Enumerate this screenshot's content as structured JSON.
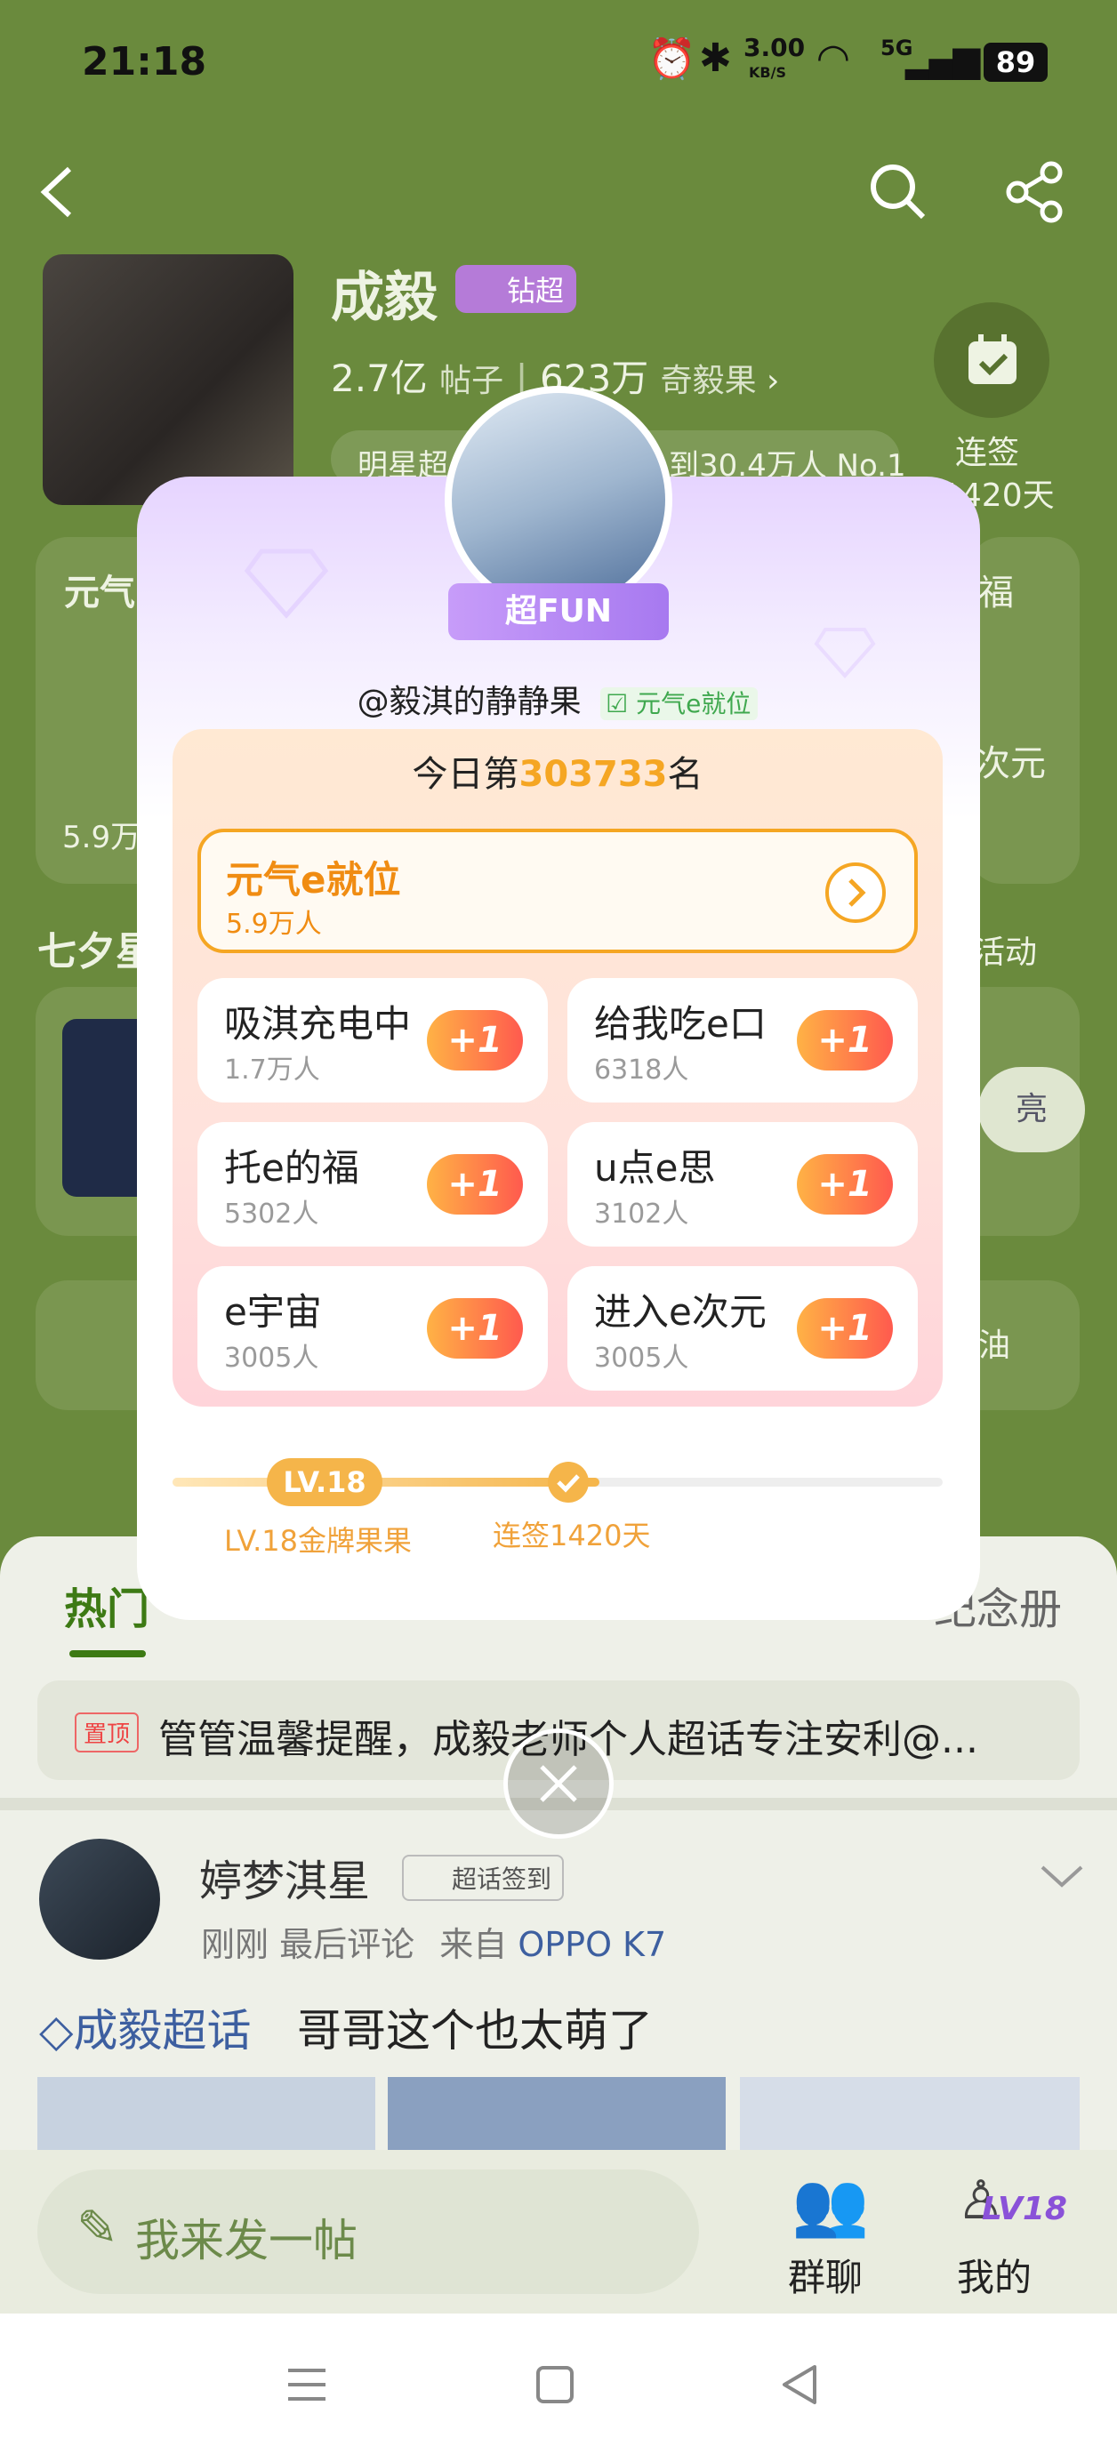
{
  "status_bar": {
    "time": "21:18",
    "speed": "3.00",
    "speed_unit": "KB/S",
    "battery": "89",
    "network": "5G"
  },
  "header": {
    "name": "成毅",
    "badge": "钻超",
    "posts": "2.7亿",
    "posts_label": "帖子",
    "fans": "623万",
    "fans_label": "奇毅果",
    "rank_text_left": "明星超",
    "rank_text_right": "到30.4万人 No.1",
    "checkin": {
      "label": "连签",
      "days": "1420天"
    }
  },
  "background": {
    "left_card_title": "元气",
    "left_card_count": "5.9万",
    "right_card_title": "福",
    "right_card_title2": "次元",
    "section_title": "七夕星",
    "section_more": "活动",
    "btn_text": "亮",
    "bottom_link": "油"
  },
  "popup": {
    "avatar_badge": "超FUN",
    "user": "@毅淇的静静果",
    "user_tag": "元气e就位",
    "rank_prefix": "今日第",
    "rank_number": "303733",
    "rank_suffix": "名",
    "highlight": {
      "name": "元气e就位",
      "count": "5.9万人"
    },
    "options": [
      {
        "name": "吸淇充电中",
        "count": "1.7万人",
        "btn": "+1"
      },
      {
        "name": "给我吃e口",
        "count": "6318人",
        "btn": "+1"
      },
      {
        "name": "托e的福",
        "count": "5302人",
        "btn": "+1"
      },
      {
        "name": "u点e思",
        "count": "3102人",
        "btn": "+1"
      },
      {
        "name": "e宇宙",
        "count": "3005人",
        "btn": "+1"
      },
      {
        "name": "进入e次元",
        "count": "3005人",
        "btn": "+1"
      }
    ],
    "level_badge": "LV.18",
    "level_label": "LV.18金牌果果",
    "checkin_label": "连签1420天"
  },
  "tabs": {
    "hot": "热门",
    "right": "纪念册"
  },
  "pinned": {
    "tag": "置顶",
    "text": "管管温馨提醒，成毅老师个人超话专注安利@..."
  },
  "post": {
    "author": "婷梦淇星",
    "author_tag": "超话签到",
    "time": "刚刚",
    "meta": "最后评论",
    "from_label": "来自",
    "device": "OPPO K7",
    "topic": "成毅超话",
    "content": "哥哥这个也太萌了"
  },
  "bottom_bar": {
    "compose": "我来发一帖",
    "group_chat": "群聊",
    "mine": "我的",
    "level_badge": "LV18"
  },
  "colors": {
    "bg_green": "#6a8a3d",
    "accent_orange": "#f5a623",
    "btn_gradient_start": "#ffb245",
    "btn_gradient_end": "#ff5a4e",
    "purple": "#a779f0"
  }
}
